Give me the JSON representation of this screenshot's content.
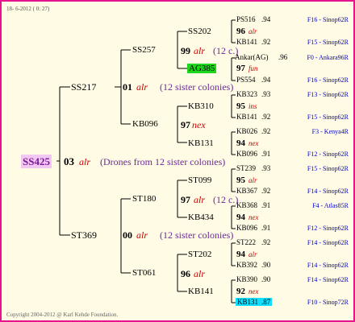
{
  "header": "18- 6-2012 ( 0: 27)",
  "footer": "Copyright 2004-2012 @ Karl Kehde Foundation.",
  "colors": {
    "border": "#e8138c",
    "background": "#fffbe4",
    "root_bg": "#f2c8f2",
    "highlight_green": "#1ed61e",
    "highlight_cyan": "#10e0ff"
  },
  "root": {
    "name": "SS425",
    "gen": "03",
    "trait": "alr",
    "note": "(Drones from 12 sister colonies)"
  },
  "level1": [
    {
      "name": "SS217",
      "gen": "01",
      "trait": "alr",
      "note": "(12 sister colonies)"
    },
    {
      "name": "ST369",
      "gen": "00",
      "trait": "alr",
      "note": "(12 sister colonies)"
    }
  ],
  "level2": [
    {
      "name": "SS257",
      "gen": "99",
      "trait": "alr",
      "note": "(12 c.)"
    },
    {
      "name": "KB096",
      "gen": "97",
      "trait": "nex",
      "note": ""
    },
    {
      "name": "ST180",
      "gen": "97",
      "trait": "alr",
      "note": "(12 c.)"
    },
    {
      "name": "ST061",
      "gen": "96",
      "trait": "alr",
      "note": ""
    }
  ],
  "level3": [
    {
      "name": "SS202",
      "gen": "96",
      "trait": "alr"
    },
    {
      "name": "AG385",
      "gen": "97",
      "trait": "fun"
    },
    {
      "name": "KB310",
      "gen": "95",
      "trait": "ins"
    },
    {
      "name": "KB131",
      "gen": "94",
      "trait": "nex"
    },
    {
      "name": "ST099",
      "gen": "95",
      "trait": "alr"
    },
    {
      "name": "KB434",
      "gen": "94",
      "trait": "nex"
    },
    {
      "name": "ST202",
      "gen": "94",
      "trait": "alr"
    },
    {
      "name": "KB141",
      "gen": "92",
      "trait": "nex"
    }
  ],
  "level4": [
    {
      "name": "PS516",
      "year": ".94",
      "lineage": "F16 - Sinop62R"
    },
    {
      "name": "KB141",
      "year": ".92",
      "lineage": "F15 - Sinop62R"
    },
    {
      "name": "Ankar(AG)",
      "year": ".96",
      "lineage": "F0 - Ankara96R"
    },
    {
      "name": "PS554",
      "year": ".94",
      "lineage": "F16 - Sinop62R"
    },
    {
      "name": "KB323",
      "year": ".93",
      "lineage": "F13 - Sinop62R"
    },
    {
      "name": "KB141",
      "year": ".92",
      "lineage": "F15 - Sinop62R"
    },
    {
      "name": "KB026",
      "year": ".92",
      "lineage": "F3 - Kenya4R"
    },
    {
      "name": "KB096",
      "year": ".91",
      "lineage": "F12 - Sinop62R"
    },
    {
      "name": "ST239",
      "year": ".93",
      "lineage": "F15 - Sinop62R"
    },
    {
      "name": "KB367",
      "year": ".92",
      "lineage": "F14 - Sinop62R"
    },
    {
      "name": "KB368",
      "year": ".91",
      "lineage": "F4 - Atlas85R"
    },
    {
      "name": "KB096",
      "year": ".91",
      "lineage": "F12 - Sinop62R"
    },
    {
      "name": "ST222",
      "year": ".92",
      "lineage": "F14 - Sinop62R"
    },
    {
      "name": "KB392",
      "year": ".90",
      "lineage": "F14 - Sinop62R"
    },
    {
      "name": "KB390",
      "year": ".90",
      "lineage": "F14 - Sinop62R"
    },
    {
      "name": "KB131",
      "year": ".87",
      "lineage": "F10 - Sinop72R"
    }
  ]
}
